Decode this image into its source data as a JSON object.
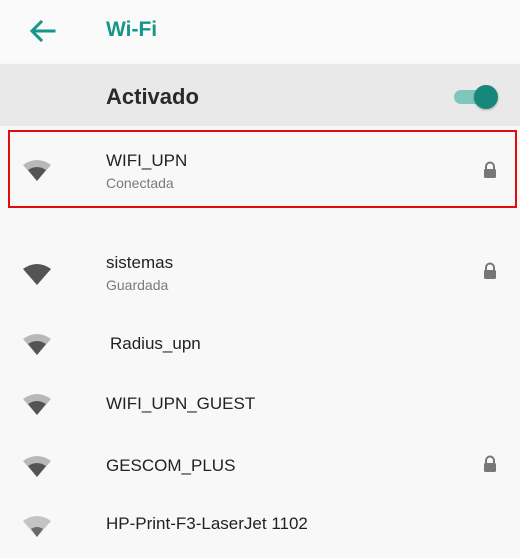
{
  "header": {
    "back_icon": "arrow-left-icon",
    "title": "Wi-Fi"
  },
  "master_switch": {
    "label": "Activado",
    "state": "on"
  },
  "networks": [
    {
      "ssid": "WIFI_UPN",
      "status": "Conectada",
      "secured": true
    },
    {
      "ssid": "sistemas",
      "status": "Guardada",
      "secured": true
    },
    {
      "ssid": "Radius_upn",
      "status": "",
      "secured": false
    },
    {
      "ssid": "WIFI_UPN_GUEST",
      "status": "",
      "secured": false
    },
    {
      "ssid": "GESCOM_PLUS",
      "status": "",
      "secured": true
    },
    {
      "ssid": "HP-Print-F3-LaserJet 1102",
      "status": "",
      "secured": false
    }
  ],
  "colors": {
    "accent": "#16968a",
    "highlight": "#e30d0d"
  }
}
